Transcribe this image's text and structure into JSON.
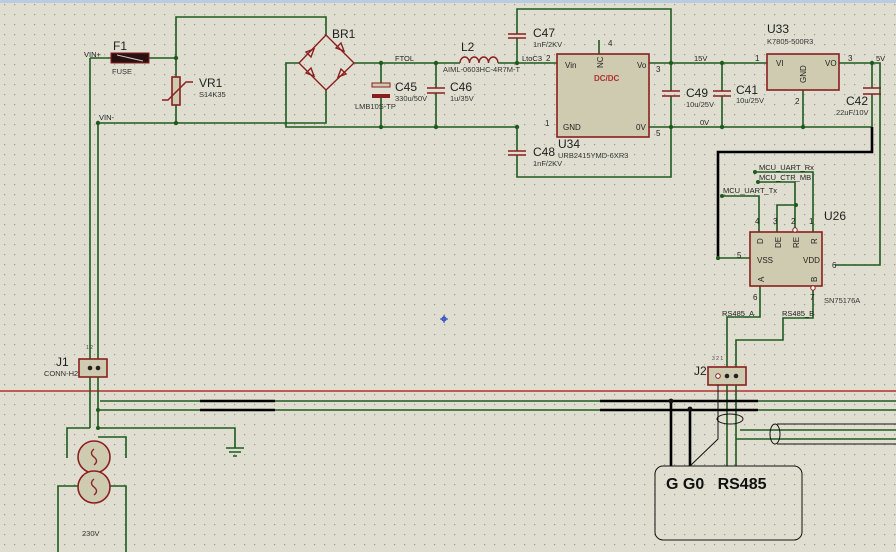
{
  "colors": {
    "background": "#dfded0",
    "wire": "#1e5a1e",
    "component": "#8a1f1f",
    "component_fill": "#cfcbb0",
    "bus": "#000000"
  },
  "nets": {
    "vin_plus": "VIN+",
    "vin_minus": "VIN-",
    "ftol": "FTOL",
    "ltoc3": "LtoC3",
    "v15": "15V",
    "v0": "0V",
    "v5": "5V",
    "uart_rx": "MCU_UART_Rx",
    "ctr_mb": "MCU_CTR_MB",
    "uart_tx": "MCU_UART_Tx",
    "rs485_a": "RS485_A",
    "rs485_b": "RS485_B"
  },
  "components": {
    "f1": {
      "ref": "F1",
      "value": "FUSE"
    },
    "vr1": {
      "ref": "VR1",
      "value": "S14K35"
    },
    "br1": {
      "ref": "BR1"
    },
    "c45": {
      "ref": "C45",
      "value": "330u/50V",
      "part": "LMB10S-TP"
    },
    "c46": {
      "ref": "C46",
      "value": "1u/35V"
    },
    "l2": {
      "ref": "L2",
      "value": "AIML-0603HC-4R7M-T"
    },
    "c47": {
      "ref": "C47",
      "value": "1nF/2KV"
    },
    "c48": {
      "ref": "C48",
      "value": "1nF/2KV"
    },
    "u34": {
      "ref": "U34",
      "value": "URB2415YMD-6XR3",
      "label": "DC/DC",
      "pins": {
        "vin": "Vin",
        "nc": "NC",
        "vo": "Vo",
        "gnd": "GND",
        "ov": "0V",
        "n2": "2",
        "n3": "3",
        "n1": "1",
        "n5": "5",
        "n4": "4"
      }
    },
    "c49": {
      "ref": "C49",
      "value": "10u/25V"
    },
    "c41": {
      "ref": "C41",
      "value": "10u/25V"
    },
    "u33": {
      "ref": "U33",
      "value": "K7805-500R3",
      "pins": {
        "vi": "VI",
        "vo": "VO",
        "gnd": "GND",
        "n1": "1",
        "n3": "3",
        "n2": "2"
      }
    },
    "c42": {
      "ref": "C42",
      "value": "22uF/10V"
    },
    "u26": {
      "ref": "U26",
      "value": "SN75176A",
      "pins": {
        "d": "D",
        "de": "DE",
        "re": "RE",
        "r": "R",
        "vss": "VSS",
        "vdd": "VDD",
        "a": "A",
        "b": "B",
        "n4": "4",
        "n3": "3",
        "n2": "2",
        "n1": "1",
        "n5": "5",
        "n6": "6",
        "n6a": "6",
        "n7": "7"
      }
    },
    "j1": {
      "ref": "J1",
      "value": "CONN-H2",
      "pins": "1 2"
    },
    "j2": {
      "ref": "J2",
      "pins": "3 2 1"
    },
    "source": {
      "value": "230V"
    }
  },
  "device_box": {
    "label": "G G0   RS485"
  }
}
